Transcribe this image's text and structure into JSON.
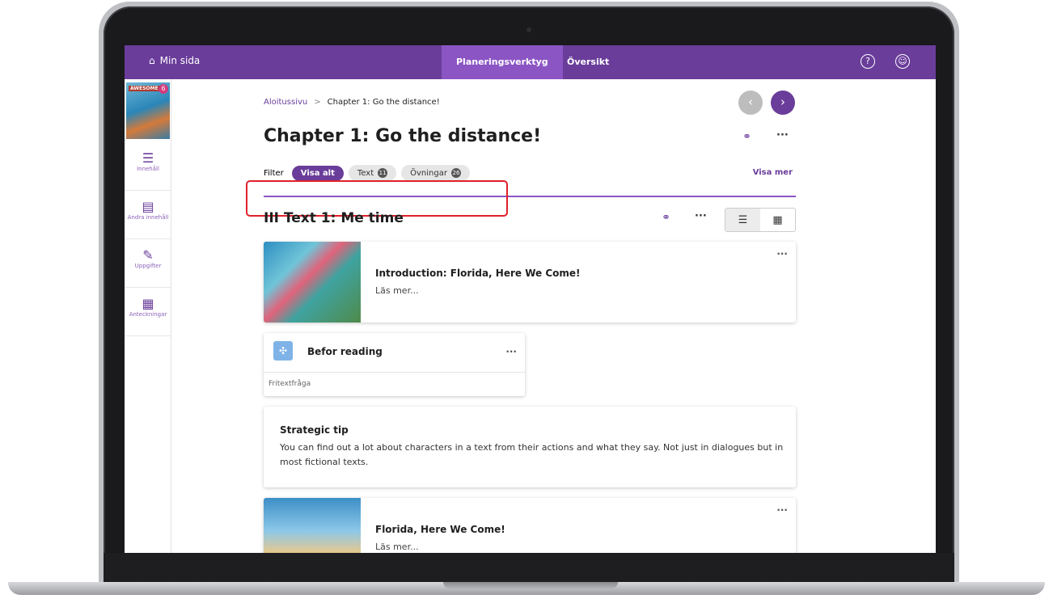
{
  "topbar": {
    "home_label": "Min sida",
    "tabs": [
      "Planeringsverktyg",
      "Översikt"
    ],
    "help_icon": "question-circle-icon",
    "user_icon": "user-circle-icon"
  },
  "sidebar": {
    "book_badge": "6",
    "book_title": "AWESOME",
    "items": [
      {
        "icon": "list-icon",
        "label": "Innehåll"
      },
      {
        "icon": "other-content-icon",
        "label": "Andra innehåll"
      },
      {
        "icon": "assignment-icon",
        "label": "Uppgifter"
      },
      {
        "icon": "notes-icon",
        "label": "Anteckningar"
      }
    ]
  },
  "breadcrumb": {
    "home": "Aloitussivu",
    "separator": ">",
    "current": "Chapter 1: Go the distance!"
  },
  "page_title": "Chapter 1: Go the distance!",
  "filter": {
    "label": "Filter",
    "chips": [
      {
        "label": "Visa alt",
        "count": ""
      },
      {
        "label": "Text",
        "count": "11"
      },
      {
        "label": "Övningar",
        "count": "26"
      }
    ],
    "show_more": "Visa mer"
  },
  "section": {
    "title": "III Text 1: Me time"
  },
  "cards": {
    "intro": {
      "title": "Introduction: Florida, Here We Come!",
      "sub": "Läs mer..."
    },
    "task": {
      "title": "Befor reading",
      "type": "Fritextfråga"
    },
    "tip": {
      "title": "Strategic tip",
      "body": "You can find out a lot about characters in a text from their actions and what they say. Not just in dialogues but in most fictional texts."
    },
    "florida": {
      "title": "Florida, Here We Come!",
      "sub": "Läs mer..."
    }
  },
  "colors": {
    "brand": "#6a3d9a",
    "brand_light": "#8b55c4",
    "highlight": "#e0202a"
  }
}
